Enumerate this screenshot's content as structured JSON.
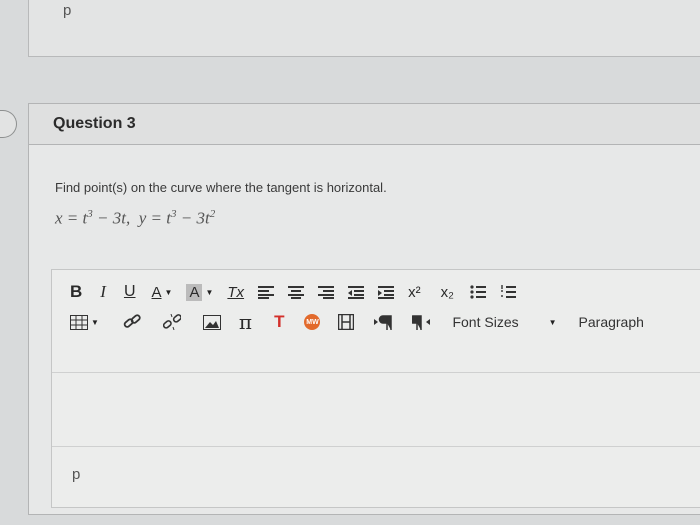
{
  "previous_panel": {
    "path_label": "p"
  },
  "question": {
    "title": "Question 3",
    "prompt": "Find point(s) on the curve where the tangent is horizontal.",
    "equation": {
      "x_lhs": "x",
      "x_rhs": "t",
      "x_exp": "3",
      "x_rest": " − 3t,",
      "y_lhs": "y",
      "y_rhs": "t",
      "y_exp": "3",
      "y_rest": " − 3t",
      "y_rest_exp": "2"
    }
  },
  "editor": {
    "toolbar": {
      "bold": "B",
      "italic": "I",
      "underline": "U",
      "font_color": "A",
      "bg_color": "A",
      "clear_format": "Tx",
      "superscript": "x²",
      "subscript": "x₂",
      "pi": "π",
      "text_t": "T",
      "mw": "MW",
      "font_sizes": "Font Sizes",
      "paragraph": "Paragraph"
    },
    "path_label": "p"
  },
  "colors": {
    "accent_red": "#d3302b",
    "accent_orange": "#e26a2c"
  }
}
